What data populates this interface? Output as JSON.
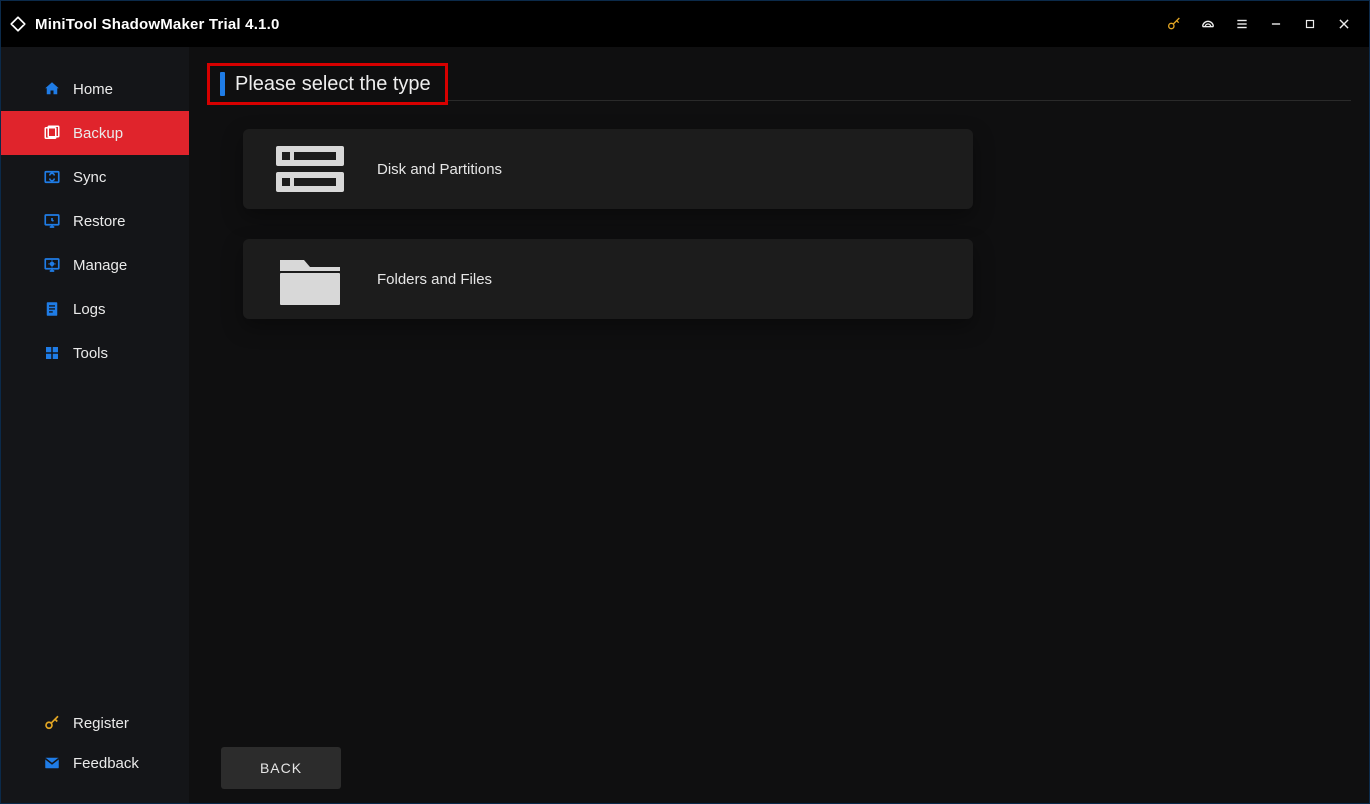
{
  "titlebar": {
    "title": "MiniTool ShadowMaker Trial 4.1.0"
  },
  "sidebar": {
    "items": [
      {
        "label": "Home"
      },
      {
        "label": "Backup"
      },
      {
        "label": "Sync"
      },
      {
        "label": "Restore"
      },
      {
        "label": "Manage"
      },
      {
        "label": "Logs"
      },
      {
        "label": "Tools"
      }
    ],
    "bottom": {
      "register": "Register",
      "feedback": "Feedback"
    }
  },
  "main": {
    "heading": "Please select the type",
    "options": [
      {
        "label": "Disk and Partitions"
      },
      {
        "label": "Folders and Files"
      }
    ],
    "back_label": "BACK"
  }
}
